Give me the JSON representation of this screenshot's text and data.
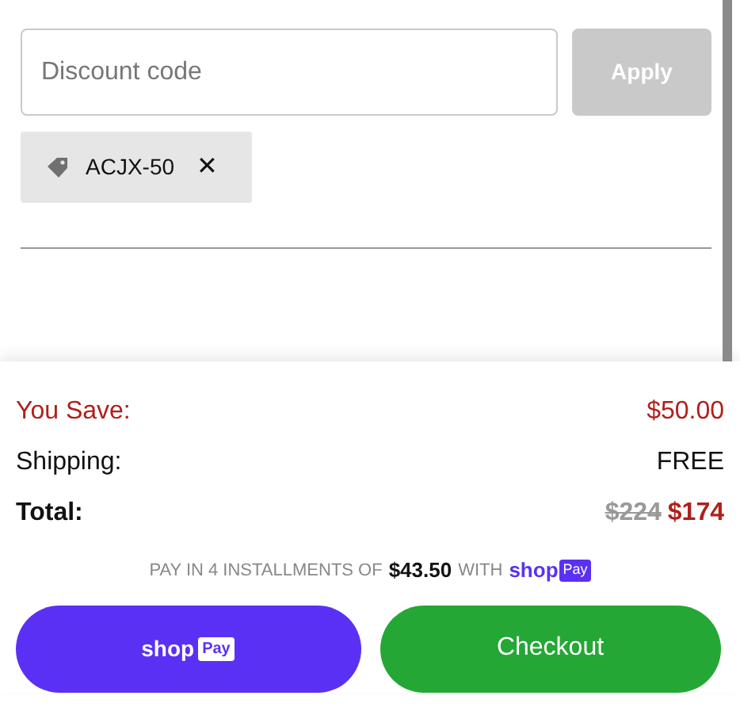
{
  "discount": {
    "placeholder": "Discount code",
    "apply_button": {
      "label": "Apply",
      "disabled": true
    }
  },
  "applied_codes": [
    {
      "code": "ACJX-50",
      "remove": "✕"
    }
  ],
  "summary": [
    {
      "kind": "savings",
      "label": "You Save:",
      "value": "$50.00"
    },
    {
      "kind": "plain",
      "label": "Shipping:",
      "value": "FREE"
    },
    {
      "kind": "total",
      "label": "Total:",
      "old_value": "$224",
      "value": "$174"
    }
  ],
  "installments": {
    "text": "PAY IN 4 INSTALLMENTS OF",
    "amount": "$43.50",
    "with": "WITH",
    "brand": "shop",
    "brand_badge": "Pay"
  },
  "buttons": [
    {
      "kind": "shoppay",
      "label": "shop",
      "badge": "Pay"
    },
    {
      "kind": "checkout",
      "label": "Checkout"
    }
  ]
}
